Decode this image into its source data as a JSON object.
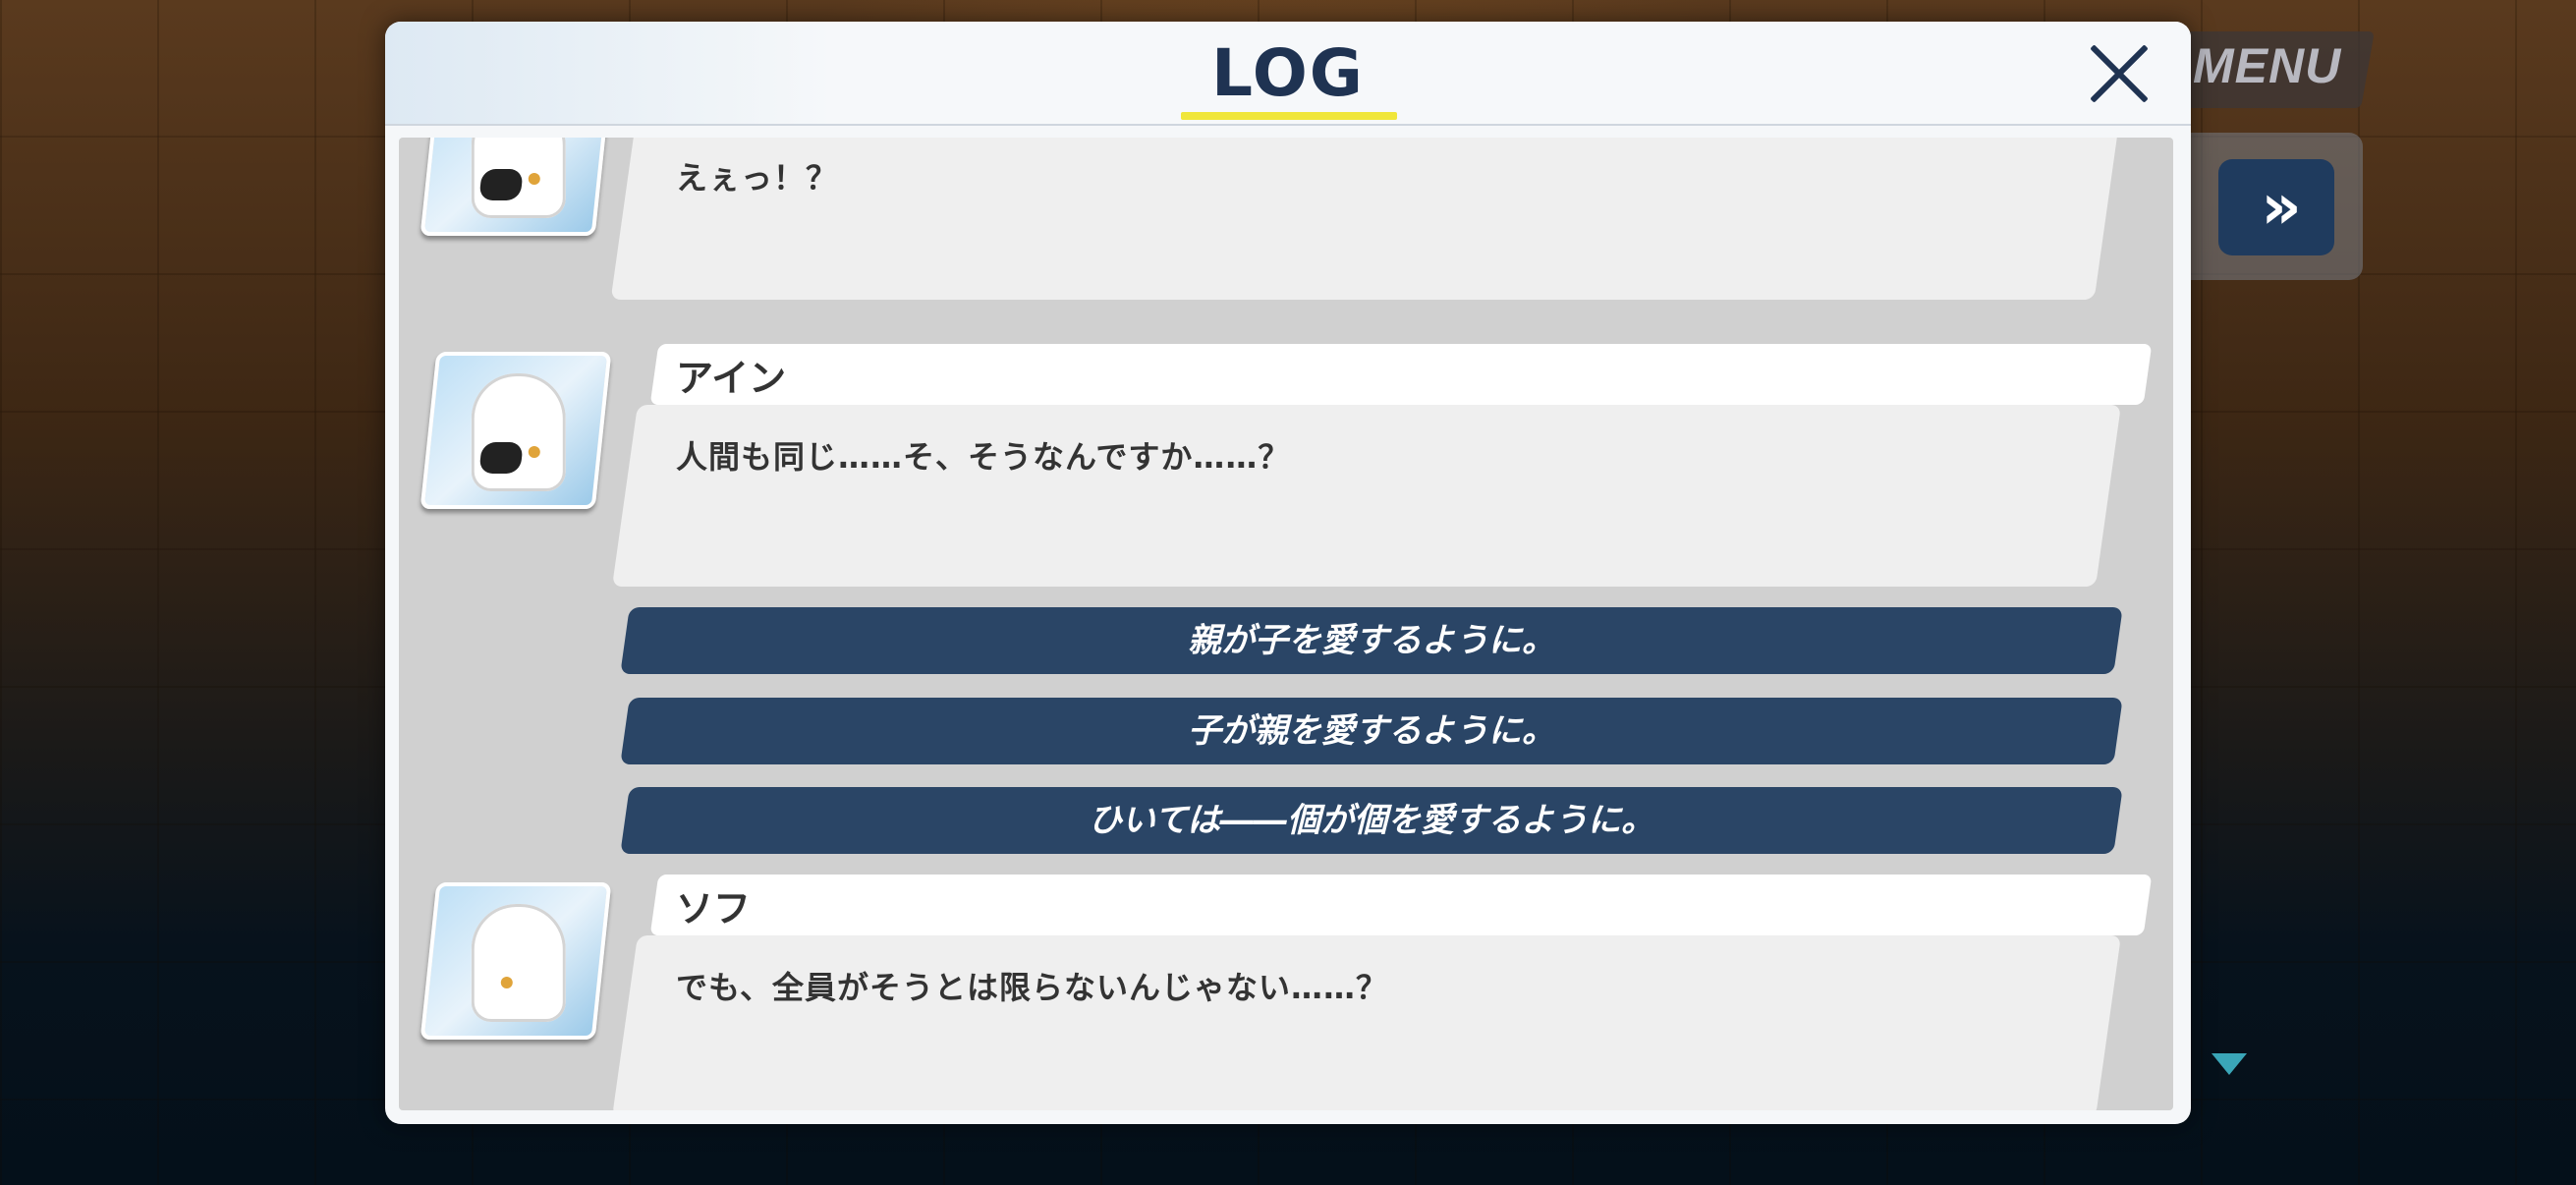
{
  "hud": {
    "menu_label": "MENU",
    "skip_glyph": "»"
  },
  "log": {
    "title": "LOG",
    "entries": [
      {
        "speaker": "",
        "text": "えぇっ！？"
      },
      {
        "speaker": "アイン",
        "text": "人間も同じ……そ、そうなんですか……？"
      },
      {
        "speaker": "ソフ",
        "text": "でも、全員がそうとは限らないんじゃない……？"
      }
    ],
    "choices": [
      "親が子を愛するように。",
      "子が親を愛するように。",
      "ひいては――個が個を愛するように。"
    ]
  },
  "colors": {
    "accent_underline": "#f0e63a",
    "choice_bg": "#2a4566",
    "title_text": "#1f3352"
  }
}
